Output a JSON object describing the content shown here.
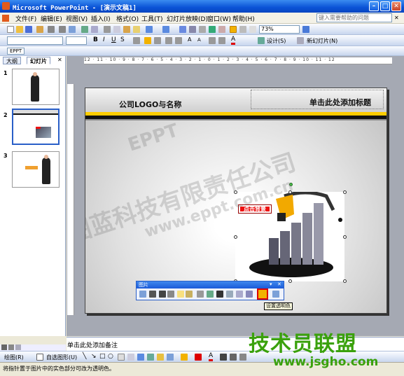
{
  "window": {
    "title": "Microsoft PowerPoint - [演示文稿1]"
  },
  "menu": {
    "items": [
      "文件(F)",
      "编辑(E)",
      "视图(V)",
      "插入(I)",
      "格式(O)",
      "工具(T)",
      "幻灯片放映(D)",
      "窗口(W)",
      "帮助(H)"
    ],
    "help_placeholder": "键入需要帮助的问题"
  },
  "toolbar": {
    "zoom": "73%",
    "design_label": "设计(S)",
    "new_slide_label": "新幻灯片(N)",
    "eppt_label": "EPPT"
  },
  "left_pane": {
    "tabs": [
      "大纲",
      "幻灯片"
    ],
    "slide_numbers": [
      "1",
      "2",
      "3"
    ]
  },
  "slide": {
    "logo_text": "公司LOGO与名称",
    "title_placeholder": "单击此处添加标题",
    "red_button": "点击背景"
  },
  "picture_toolbar": {
    "title": "图片",
    "tooltip": "设置透明色"
  },
  "notes": {
    "placeholder": "单击此处添加备注"
  },
  "draw_toolbar": {
    "draw_label": "绘图(R)",
    "autoshape_label": "自选图形(U)"
  },
  "status": {
    "text": "将指针置于图片中的实色部分可改为透明色。"
  },
  "watermarks": {
    "eppt": "EPPT",
    "company": "天津图蓝科技有限责任公司",
    "url": "www.eppt.com.cn",
    "brand": "技术员联盟",
    "brand_url": "www.jsgho.com"
  },
  "colors": {
    "accent_yellow": "#ffcc00",
    "brand_green": "#3aa10c",
    "title_blue": "#0a52d6"
  }
}
